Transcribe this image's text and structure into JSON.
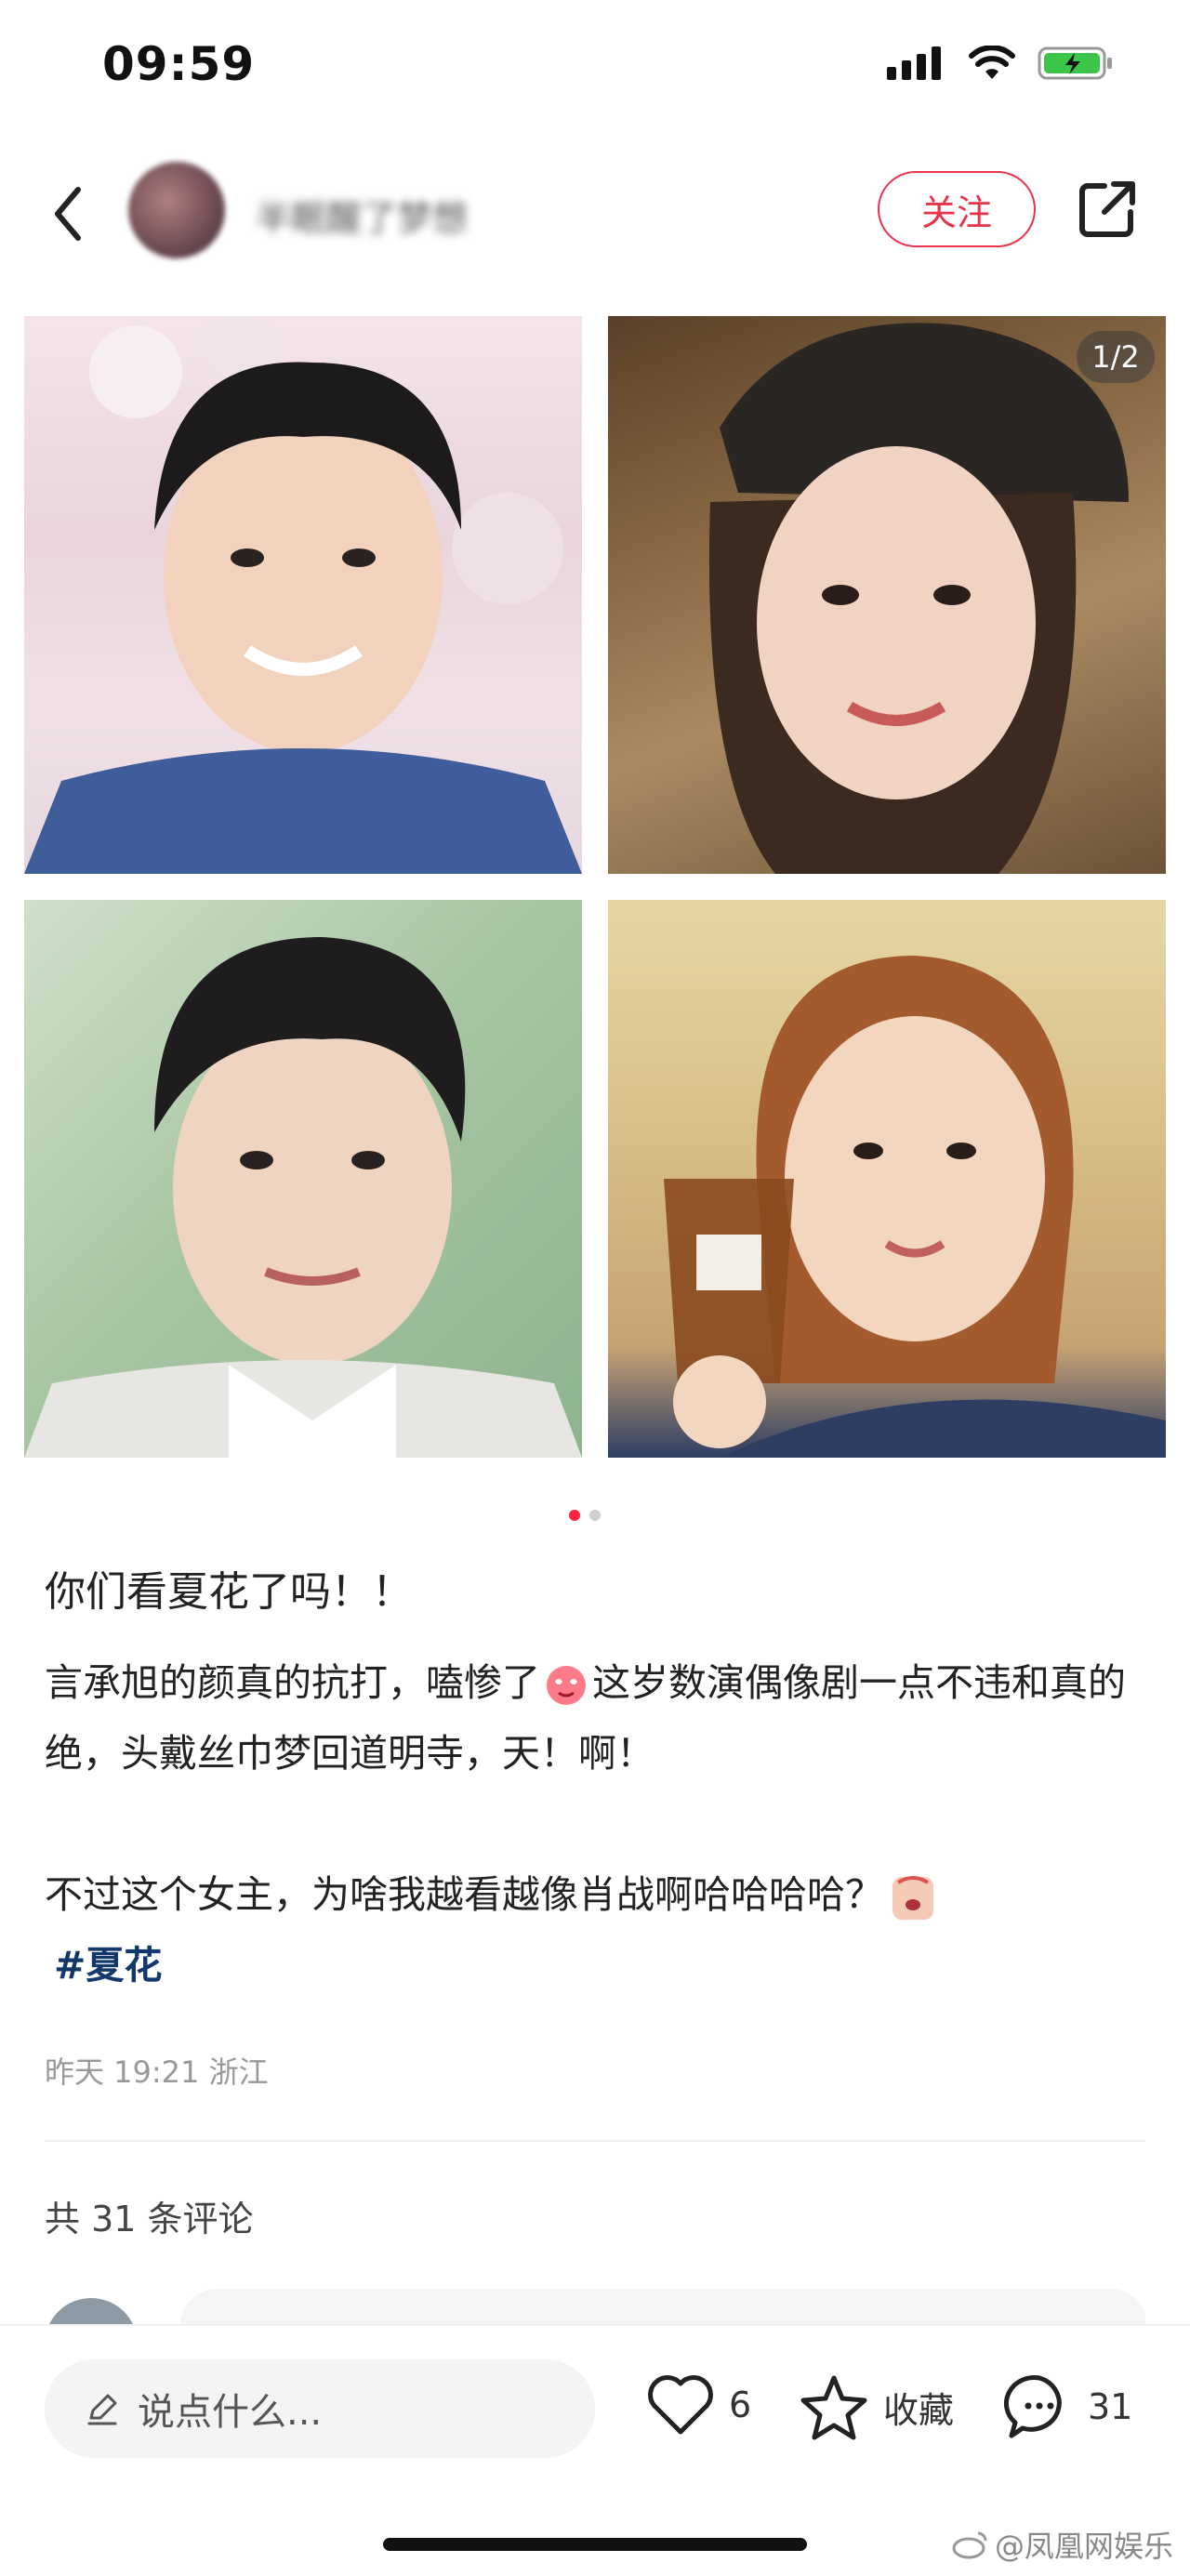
{
  "status_bar": {
    "time": "09:59",
    "icons": [
      "signal-icon",
      "wifi-icon",
      "battery-charging-icon"
    ]
  },
  "header": {
    "author_name": "半眠醒了梦想",
    "follow_label": "关注",
    "icons": [
      "back-arrow-icon",
      "share-icon"
    ]
  },
  "gallery": {
    "page_counter": "1/2",
    "current_page": 1,
    "total_pages": 2
  },
  "post": {
    "title": "你们看夏花了吗！！",
    "body_line1_a": "言承旭的颜真的抗打，嗑惨了",
    "body_line1_b": "这岁数演偶像剧一点不违和真的绝，头戴丝巾梦回道明寺，天！啊！",
    "body_para2": "不过这个女主，为啥我越看越像肖战啊哈哈哈哈？",
    "hashtag": "#夏花",
    "meta": "昨天 19:21 浙江"
  },
  "comments": {
    "count_label": "共 31 条评论"
  },
  "bottom_bar": {
    "input_placeholder": "说点什么...",
    "like_count": "6",
    "collect_label": "收藏",
    "comment_count": "31"
  },
  "watermark": "@凤凰网娱乐",
  "colors": {
    "accent": "#ff2442",
    "follow": "#e8334a",
    "hashtag": "#13386c"
  }
}
